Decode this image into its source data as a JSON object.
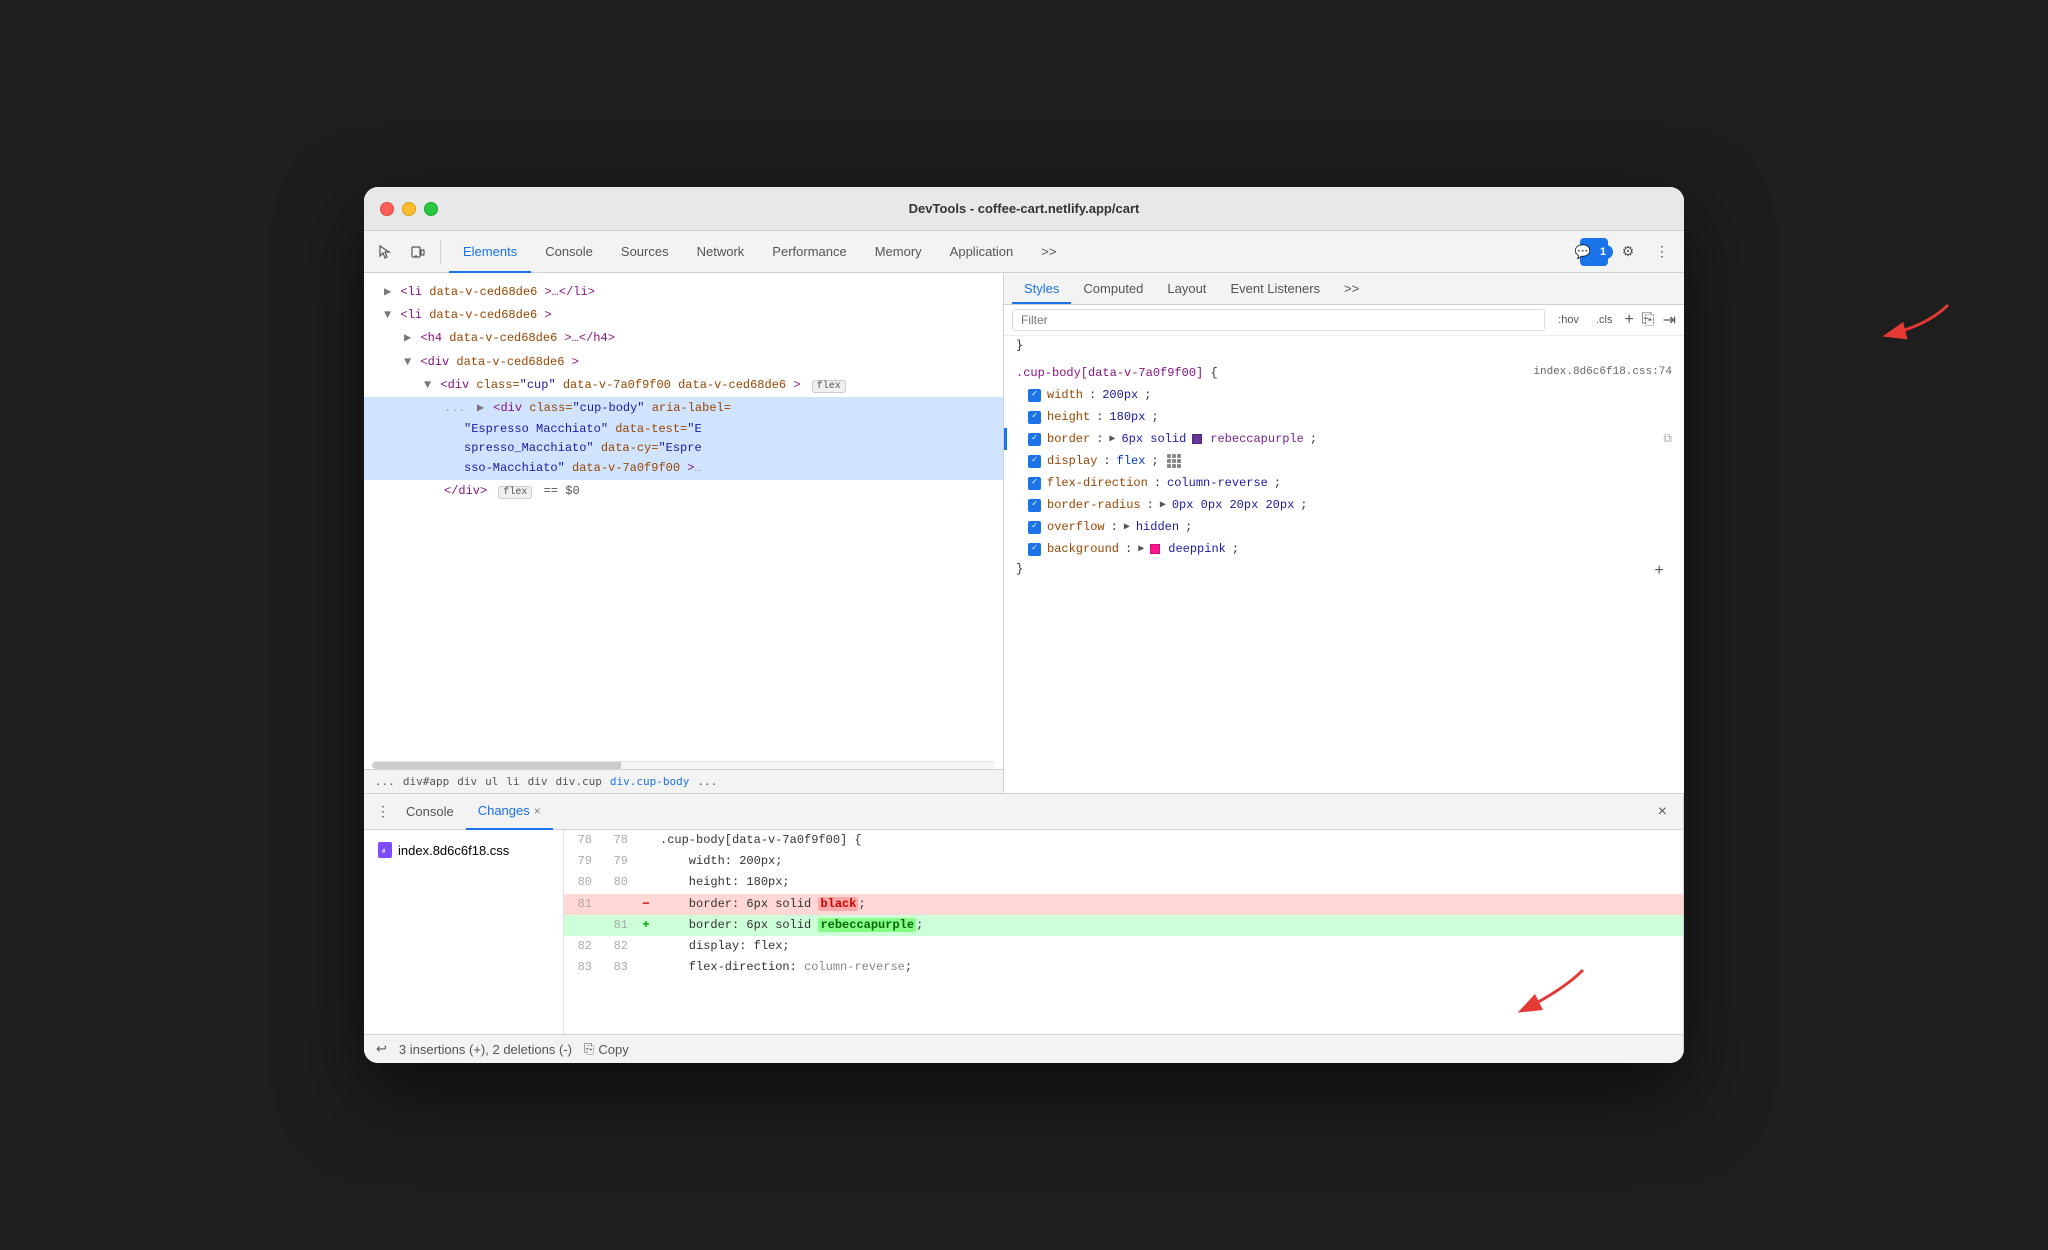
{
  "window": {
    "title": "DevTools - coffee-cart.netlify.app/cart",
    "traffic_lights": [
      "red",
      "yellow",
      "green"
    ]
  },
  "devtools": {
    "tabs": [
      {
        "label": "Elements",
        "active": true
      },
      {
        "label": "Console",
        "active": false
      },
      {
        "label": "Sources",
        "active": false
      },
      {
        "label": "Network",
        "active": false
      },
      {
        "label": "Performance",
        "active": false
      },
      {
        "label": "Memory",
        "active": false
      },
      {
        "label": "Application",
        "active": false
      }
    ],
    "more_tabs_label": ">>",
    "chat_badge": "1",
    "gear_label": "⚙",
    "more_label": "⋮"
  },
  "elements_panel": {
    "tree": [
      {
        "id": 1,
        "indent": "indent-1",
        "html": "&lt;li data-v-ced68de6&gt;…&lt;/li&gt;",
        "selected": false
      },
      {
        "id": 2,
        "indent": "indent-1",
        "html": "&lt;li data-v-ced68de6&gt;",
        "selected": false
      },
      {
        "id": 3,
        "indent": "indent-2",
        "html": "&lt;h4 data-v-ced68de6&gt;…&lt;/h4&gt;",
        "selected": false
      },
      {
        "id": 4,
        "indent": "indent-2",
        "html": "&lt;div data-v-ced68de6&gt;",
        "selected": false
      },
      {
        "id": 5,
        "indent": "indent-3",
        "html": "&lt;div class=\"cup\" data-v-7a0f9f00 data-v-ced68de6&gt;",
        "badge": "flex",
        "selected": false
      },
      {
        "id": 6,
        "indent": "indent-4",
        "html": "&lt;div class=\"cup-body\" aria-label= \"Espresso Macchiato\" data-test=\"Espresso_Macchiato\" data-cy=\"Espresso-Macchiato\" data-v-7a0f9f00&gt;…",
        "selected": true
      },
      {
        "id": 7,
        "indent": "indent-4",
        "html": "&lt;/div&gt;",
        "badge": "flex",
        "dollar": "== $0",
        "selected": false
      }
    ],
    "breadcrumb": [
      "...",
      "div#app",
      "div",
      "ul",
      "li",
      "div",
      "div.cup",
      "div.cup-body",
      "..."
    ]
  },
  "styles_panel": {
    "tabs": [
      "Styles",
      "Computed",
      "Layout",
      "Event Listeners"
    ],
    "active_tab": "Styles",
    "more_tabs": ">>",
    "filter_placeholder": "Filter",
    "hov_label": ":hov",
    "cls_label": ".cls",
    "plus_label": "+",
    "selector": ".cup-body[data-v-7a0f9f00] {",
    "file_ref": "index.8d6c6f18.css:74",
    "properties": [
      {
        "name": "width",
        "value": "200px",
        "checked": true,
        "color": null
      },
      {
        "name": "height",
        "value": "180px",
        "checked": true,
        "color": null
      },
      {
        "name": "border",
        "value": "6px solid",
        "checked": true,
        "color": "rebeccapurple",
        "color_hex": "#663399",
        "highlight": true,
        "copy": true
      },
      {
        "name": "display",
        "value": "flex",
        "checked": true,
        "grid": true
      },
      {
        "name": "flex-direction",
        "value": "column-reverse",
        "checked": true
      },
      {
        "name": "border-radius",
        "value": "0px 0px 20px 20px",
        "checked": true
      },
      {
        "name": "overflow",
        "value": "hidden",
        "checked": true
      },
      {
        "name": "background",
        "value": "deeppink",
        "checked": true,
        "color": "deeppink",
        "color_hex": "#ff1493"
      }
    ],
    "close_brace": "}"
  },
  "bottom_panel": {
    "console_tab": "Console",
    "changes_tab": "Changes",
    "active_tab": "Changes",
    "file_name": "index.8d6c6f18.css",
    "diff": [
      {
        "line_old": "78",
        "line_new": "78",
        "sign": "",
        "code": ".cup-body[data-v-7a0f9f00] {",
        "type": "context"
      },
      {
        "line_old": "79",
        "line_new": "79",
        "sign": "",
        "code": "    width: 200px;",
        "type": "context"
      },
      {
        "line_old": "80",
        "line_new": "80",
        "sign": "",
        "code": "    height: 180px;",
        "type": "context"
      },
      {
        "line_old": "81",
        "line_new": "",
        "sign": "-",
        "code": "    border: 6px solid black;",
        "type": "removed",
        "highlight": "black"
      },
      {
        "line_old": "",
        "line_new": "81",
        "sign": "+",
        "code": "    border: 6px solid rebeccapurple;",
        "type": "added",
        "highlight": "rebeccapurple"
      },
      {
        "line_old": "82",
        "line_new": "82",
        "sign": "",
        "code": "    display: flex;",
        "type": "context"
      },
      {
        "line_old": "83",
        "line_new": "83",
        "sign": "",
        "code": "    flex-direction: column-reverse;",
        "type": "context"
      }
    ],
    "summary": "3 insertions (+), 2 deletions (-)",
    "undo_label": "↩",
    "copy_label": "Copy"
  }
}
